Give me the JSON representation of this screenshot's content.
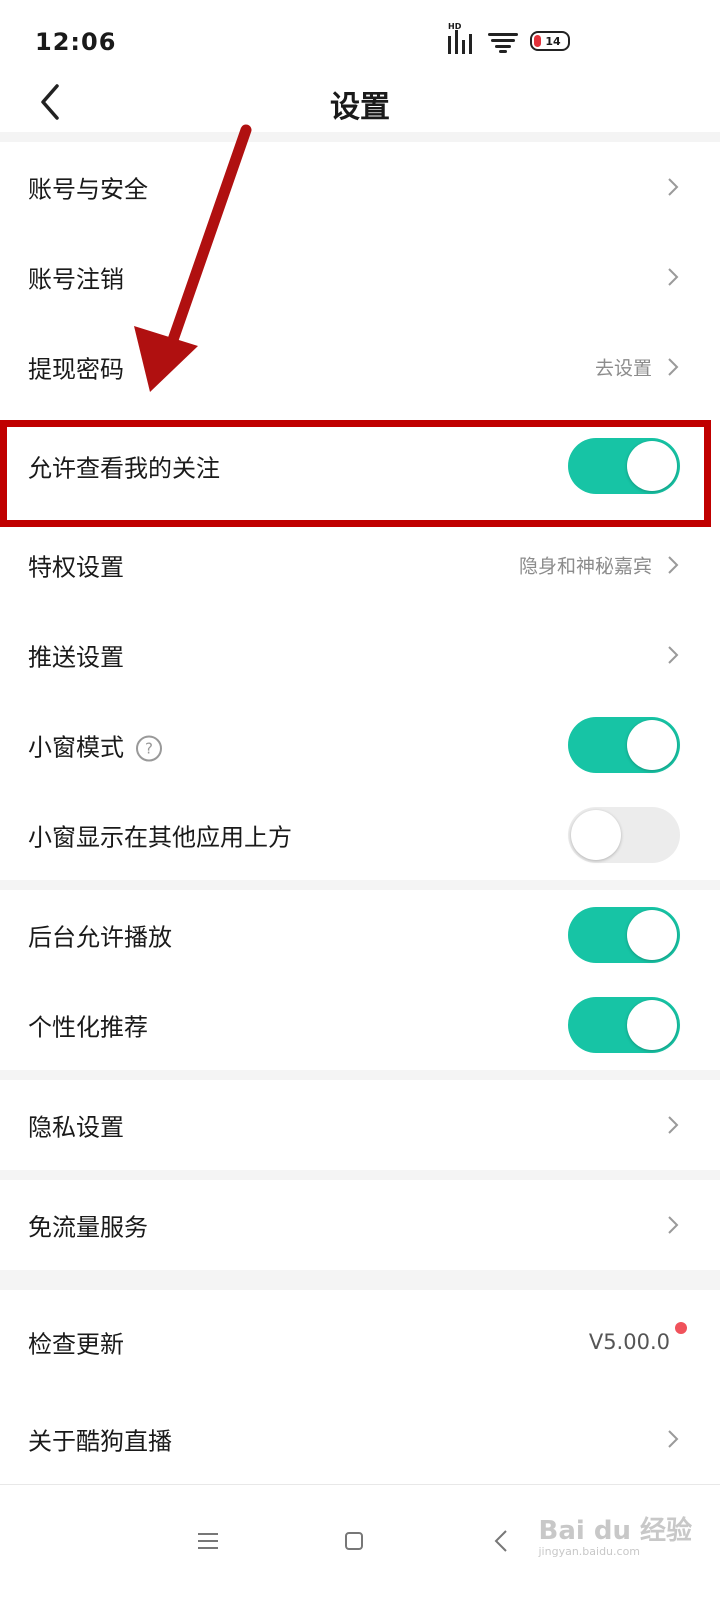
{
  "status_bar": {
    "time": "12:06",
    "network": "HD",
    "battery": "14"
  },
  "header": {
    "title": "设置"
  },
  "groups": [
    {
      "items": [
        {
          "label": "账号与安全"
        },
        {
          "label": "账号注销"
        },
        {
          "label": "提现密码",
          "value": "去设置"
        },
        {
          "label": "允许查看我的关注",
          "toggle": true
        },
        {
          "label": "特权设置",
          "value": "隐身和神秘嘉宾"
        },
        {
          "label": "推送设置"
        }
      ]
    },
    {
      "items": [
        {
          "label": "小窗模式",
          "toggle": true
        },
        {
          "label": "小窗显示在其他应用上方",
          "toggle": false
        }
      ]
    },
    {
      "items": [
        {
          "label": "后台允许播放",
          "toggle": true
        },
        {
          "label": "个性化推荐",
          "toggle": true
        }
      ]
    },
    {
      "items": [
        {
          "label": "隐私设置"
        }
      ]
    },
    {
      "items": [
        {
          "label": "免流量服务"
        }
      ]
    },
    {
      "items": [
        {
          "label": "检查更新",
          "value": "V5.00.0"
        },
        {
          "label": "关于酷狗直播"
        }
      ]
    }
  ],
  "annotation": {
    "highlight_color": "#c00000",
    "accent_color": "#17c4a5"
  },
  "watermark": {
    "brand": "Bai du 经验",
    "url": "jingyan.baidu.com"
  }
}
